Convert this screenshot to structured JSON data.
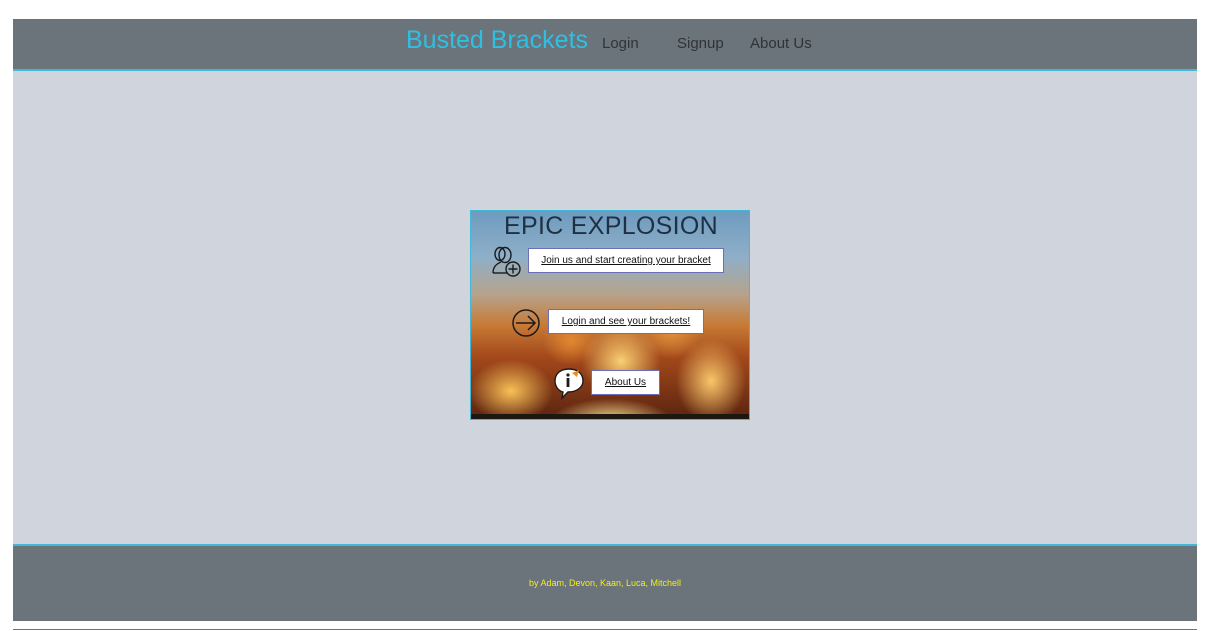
{
  "header": {
    "brand": "Busted Brackets",
    "nav": [
      {
        "label": "Login"
      },
      {
        "label": "Signup"
      },
      {
        "label": "About Us"
      }
    ]
  },
  "card": {
    "title": "EPIC EXPLOSION",
    "actions": [
      {
        "label": "Join us and start creating your bracket",
        "icon": "add-user-icon"
      },
      {
        "label": "Login and see your brackets!",
        "icon": "arrow-right-circle-icon"
      },
      {
        "label": "About Us",
        "icon": "info-speech-bubble-icon"
      }
    ]
  },
  "footer": {
    "credits": "by Adam, Devon, Kaan, Luca, Mitchell"
  },
  "colors": {
    "header_bg": "#6b737b",
    "brand": "#2ec0e3",
    "main_bg": "#d0d4dc",
    "accent_border": "#3fb9d6",
    "footer_text": "#f4f016"
  }
}
